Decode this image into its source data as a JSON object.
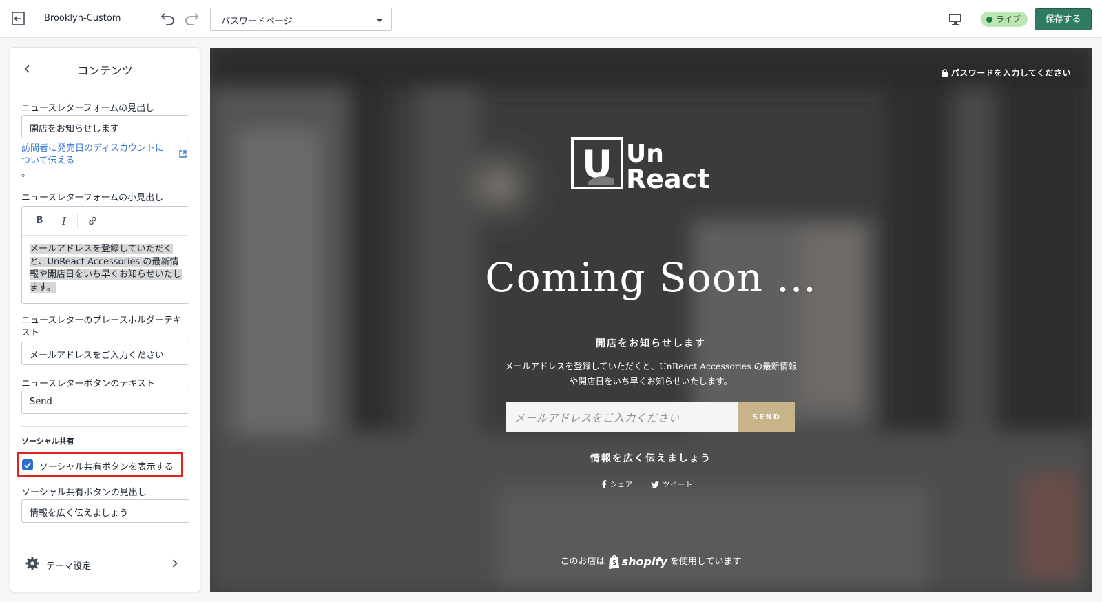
{
  "topbar": {
    "theme_name": "Brooklyn-Custom",
    "page_select": "パスワードページ",
    "live_label": "ライブ",
    "save_label": "保存する"
  },
  "sidebar": {
    "title": "コンテンツ",
    "newsletter_heading_label": "ニュースレターフォームの見出し",
    "newsletter_heading_value": "開店をお知らせします",
    "help_link": "訪問者に発売日のディスカウントについて伝える",
    "help_suffix": "。",
    "subheading_label": "ニュースレターフォームの小見出し",
    "rte_bold": "B",
    "rte_italic": "I",
    "subheading_value": "メールアドレスを登録していただくと、UnReact Accessories の最新情報や開店日をいち早くお知らせいたします。",
    "placeholder_label": "ニュースレターのプレースホルダーテキスト",
    "placeholder_value": "メールアドレスをご入力ください",
    "button_text_label": "ニュースレターボタンのテキスト",
    "button_text_value": "Send",
    "social_section": "ソーシャル共有",
    "social_checkbox_label": "ソーシャル共有ボタンを表示する",
    "social_checked": true,
    "social_heading_label": "ソーシャル共有ボタンの見出し",
    "social_heading_value": "情報を広く伝えましょう",
    "footer_label": "テーマ設定"
  },
  "preview": {
    "password_link": "パスワードを入力してください",
    "logo_line1": "Un",
    "logo_line2": "React",
    "logo_letter": "U",
    "title": "Coming Soon ...",
    "newsletter_heading": "開店をお知らせします",
    "newsletter_sub": "メールアドレスを登録していただくと、UnReact Accessories の最新情報や開店日をいち早くお知らせいたします。",
    "email_placeholder": "メールアドレスをご入力ください",
    "send_label": "SEND",
    "share_heading": "情報を広く伝えましょう",
    "share_facebook": "シェア",
    "share_twitter": "ツイート",
    "powered_prefix": "このお店は",
    "powered_brand": "shopify",
    "powered_suffix": "を使用しています"
  },
  "colors": {
    "accent": "#2f7b5f",
    "live_badge": "#bbe5b3",
    "send_button": "#c9b38a",
    "highlight_box": "#e0221c",
    "checkbox": "#2c6ecb"
  }
}
